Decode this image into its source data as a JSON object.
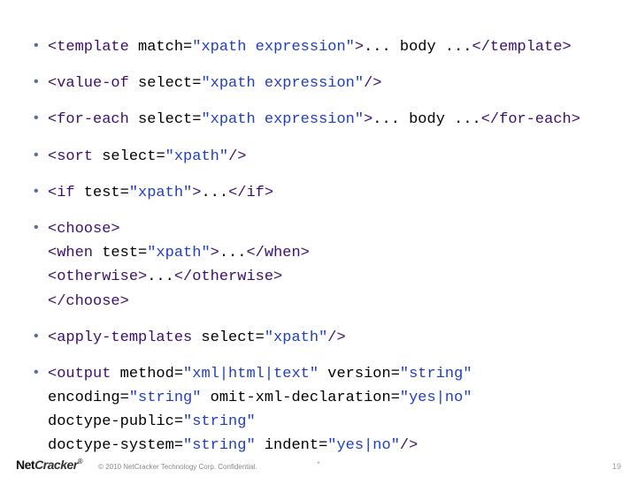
{
  "bullets": [
    {
      "lines": [
        {
          "segments": [
            {
              "c": "tag",
              "t": "<template"
            },
            {
              "c": "attr",
              "t": " match"
            },
            {
              "c": "eq",
              "t": "="
            },
            {
              "c": "val",
              "t": "\"xpath expression\""
            },
            {
              "c": "tag",
              "t": ">"
            },
            {
              "c": "body",
              "t": "... body ..."
            },
            {
              "c": "tag",
              "t": "</template>"
            }
          ]
        }
      ]
    },
    {
      "lines": [
        {
          "segments": [
            {
              "c": "tag",
              "t": "<value-of"
            },
            {
              "c": "attr",
              "t": " select"
            },
            {
              "c": "eq",
              "t": "="
            },
            {
              "c": "val",
              "t": "\"xpath expression\""
            },
            {
              "c": "tag",
              "t": "/>"
            }
          ]
        }
      ]
    },
    {
      "lines": [
        {
          "segments": [
            {
              "c": "tag",
              "t": "<for-each"
            },
            {
              "c": "attr",
              "t": " select"
            },
            {
              "c": "eq",
              "t": "="
            },
            {
              "c": "val",
              "t": "\"xpath expression\""
            },
            {
              "c": "tag",
              "t": ">"
            },
            {
              "c": "body",
              "t": "... body ..."
            },
            {
              "c": "tag",
              "t": "</for-each>"
            }
          ]
        }
      ]
    },
    {
      "lines": [
        {
          "segments": [
            {
              "c": "tag",
              "t": "<sort"
            },
            {
              "c": "attr",
              "t": " select"
            },
            {
              "c": "eq",
              "t": "="
            },
            {
              "c": "val",
              "t": "\"xpath\""
            },
            {
              "c": "tag",
              "t": "/>"
            }
          ]
        }
      ]
    },
    {
      "lines": [
        {
          "segments": [
            {
              "c": "tag",
              "t": "<if"
            },
            {
              "c": "attr",
              "t": " test"
            },
            {
              "c": "eq",
              "t": "="
            },
            {
              "c": "val",
              "t": "\"xpath\""
            },
            {
              "c": "tag",
              "t": ">"
            },
            {
              "c": "body",
              "t": "..."
            },
            {
              "c": "tag",
              "t": "</if>"
            }
          ]
        }
      ]
    },
    {
      "lines": [
        {
          "segments": [
            {
              "c": "tag",
              "t": "<choose>"
            }
          ]
        },
        {
          "segments": [
            {
              "c": "tag",
              "t": "<when"
            },
            {
              "c": "attr",
              "t": " test"
            },
            {
              "c": "eq",
              "t": "="
            },
            {
              "c": "val",
              "t": "\"xpath\""
            },
            {
              "c": "tag",
              "t": ">"
            },
            {
              "c": "body",
              "t": "..."
            },
            {
              "c": "tag",
              "t": "</when>"
            }
          ]
        },
        {
          "segments": [
            {
              "c": "tag",
              "t": "<otherwise>"
            },
            {
              "c": "body",
              "t": "..."
            },
            {
              "c": "tag",
              "t": "</otherwise>"
            }
          ]
        },
        {
          "segments": [
            {
              "c": "tag",
              "t": "</choose>"
            }
          ]
        }
      ]
    },
    {
      "lines": [
        {
          "segments": [
            {
              "c": "tag",
              "t": "<apply-templates"
            },
            {
              "c": "attr",
              "t": " select"
            },
            {
              "c": "eq",
              "t": "="
            },
            {
              "c": "val",
              "t": "\"xpath\""
            },
            {
              "c": "tag",
              "t": "/>"
            }
          ]
        }
      ]
    },
    {
      "lines": [
        {
          "segments": [
            {
              "c": "tag",
              "t": "<output"
            },
            {
              "c": "attr",
              "t": " method"
            },
            {
              "c": "eq",
              "t": "="
            },
            {
              "c": "val",
              "t": "\"xml|html|text\""
            },
            {
              "c": "attr",
              "t": " version"
            },
            {
              "c": "eq",
              "t": "="
            },
            {
              "c": "val",
              "t": "\"string\""
            }
          ]
        },
        {
          "segments": [
            {
              "c": "attr",
              "t": "encoding"
            },
            {
              "c": "eq",
              "t": "="
            },
            {
              "c": "val",
              "t": "\"string\""
            },
            {
              "c": "attr",
              "t": " omit-xml-declaration"
            },
            {
              "c": "eq",
              "t": "="
            },
            {
              "c": "val",
              "t": "\"yes|no\""
            }
          ]
        },
        {
          "segments": [
            {
              "c": "attr",
              "t": "doctype-public"
            },
            {
              "c": "eq",
              "t": "="
            },
            {
              "c": "val",
              "t": "\"string\""
            }
          ]
        },
        {
          "segments": [
            {
              "c": "attr",
              "t": "doctype-system"
            },
            {
              "c": "eq",
              "t": "="
            },
            {
              "c": "val",
              "t": "\"string\""
            },
            {
              "c": "attr",
              "t": " indent"
            },
            {
              "c": "eq",
              "t": "="
            },
            {
              "c": "val",
              "t": "\"yes|no\""
            },
            {
              "c": "tag",
              "t": "/>"
            }
          ]
        }
      ]
    }
  ],
  "footer": {
    "logo_main": "Net",
    "logo_italic": "Cracker",
    "logo_sup": "®",
    "copyright": "© 2010 NetCracker Technology Corp. Confidential.",
    "star": "*",
    "page": "19"
  }
}
